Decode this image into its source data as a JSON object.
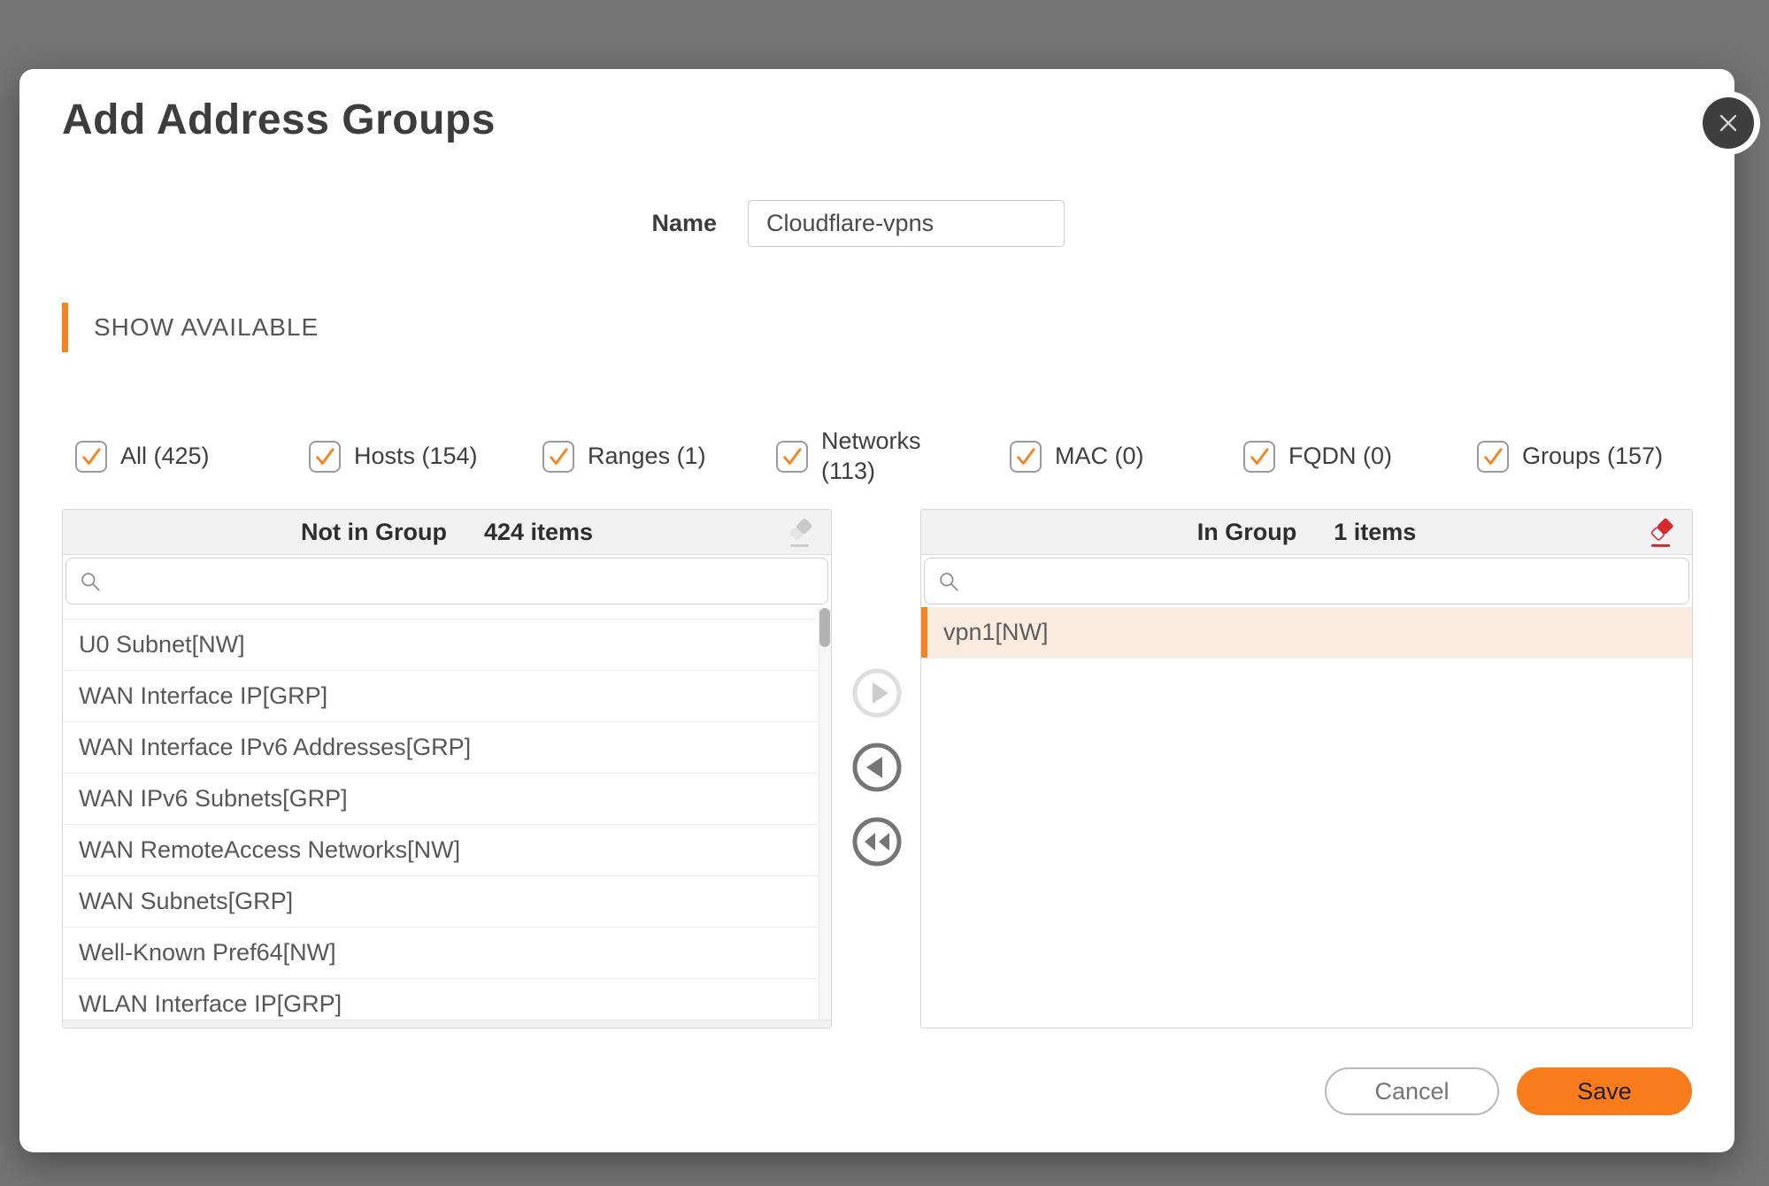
{
  "dialog": {
    "title": "Add Address Groups",
    "name_label": "Name",
    "name_value": "Cloudflare-vpns",
    "section_label": "SHOW AVAILABLE"
  },
  "filters": [
    {
      "label": "All (425)",
      "checked": true
    },
    {
      "label": "Hosts (154)",
      "checked": true
    },
    {
      "label": "Ranges (1)",
      "checked": true
    },
    {
      "label": "Networks (113)",
      "checked": true
    },
    {
      "label": "MAC (0)",
      "checked": true
    },
    {
      "label": "FQDN (0)",
      "checked": true
    },
    {
      "label": "Groups (157)",
      "checked": true
    }
  ],
  "panels": {
    "left": {
      "title": "Not in Group",
      "count": "424 items",
      "search_placeholder": "",
      "items": [
        "U0 Subnet[NW]",
        "WAN Interface IP[GRP]",
        "WAN Interface IPv6 Addresses[GRP]",
        "WAN IPv6 Subnets[GRP]",
        "WAN RemoteAccess Networks[NW]",
        "WAN Subnets[GRP]",
        "Well-Known Pref64[NW]",
        "WLAN Interface IP[GRP]"
      ]
    },
    "right": {
      "title": "In Group",
      "count": "1 items",
      "search_placeholder": "",
      "items": [
        "vpn1[NW]"
      ]
    }
  },
  "footer": {
    "cancel_label": "Cancel",
    "save_label": "Save"
  },
  "colors": {
    "accent": "#F5831F",
    "save_bg": "#F97C1C",
    "selected_row_bg": "#FCECE0",
    "eraser_red": "#D7282F",
    "eraser_gray": "#C9C9C9"
  }
}
